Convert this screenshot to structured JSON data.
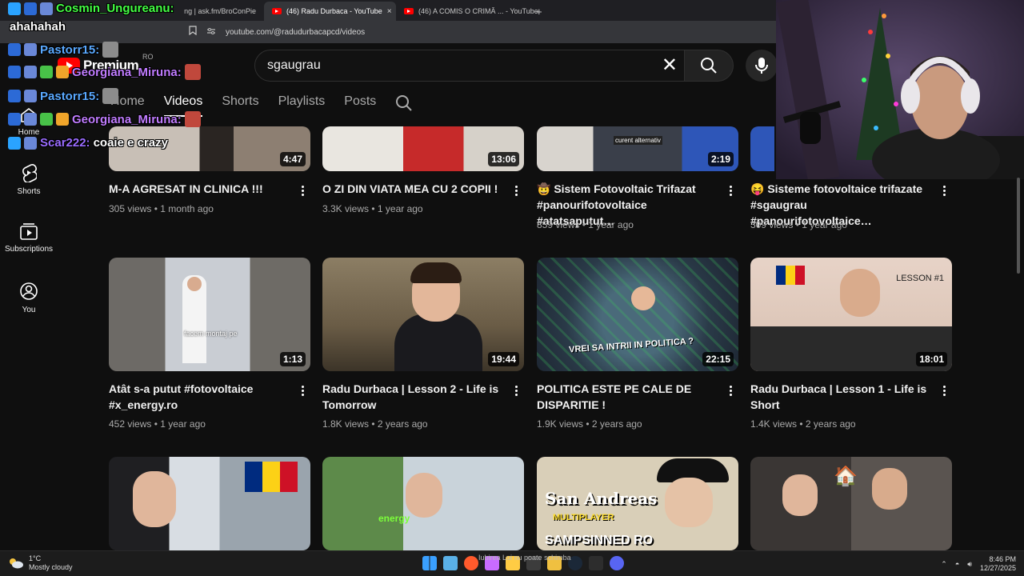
{
  "browser": {
    "tabs": [
      {
        "label": "ng | ask.fm/BroConPie"
      },
      {
        "label": "(46) Radu Durbaca - YouTube",
        "close": "×"
      },
      {
        "label": "(46) A COMIS O CRIMĂ ... - YouTube"
      }
    ],
    "new_tab": "+",
    "url": "youtube.com/@radudurbacapcd/videos"
  },
  "youtube": {
    "logo_text": "Premium",
    "region": "RO",
    "search_value": "sgaugrau",
    "clear": "✕",
    "channel_tabs": [
      "Home",
      "Videos",
      "Shorts",
      "Playlists",
      "Posts"
    ],
    "active_tab": "Videos",
    "sidebar": [
      {
        "label": "Home"
      },
      {
        "label": "Shorts"
      },
      {
        "label": "Subscriptions"
      },
      {
        "label": "You"
      }
    ],
    "videos": [
      {
        "title": "M-A AGRESAT IN CLINICA !!!",
        "meta": "305 views • 1 month ago",
        "duration": "4:47"
      },
      {
        "title": "O ZI DIN VIATA MEA CU 2 COPII !",
        "meta": "3.3K views • 1 year ago",
        "duration": "13:06"
      },
      {
        "title": "🤠 Sistem Fotovoltaic Trifazat #panourifotovoltaice #atatsaputut…",
        "meta": "859 views • 1 year ago",
        "duration": "2:19"
      },
      {
        "title": "😝 Sisteme fotovoltaice trifazate #sgaugrau #panourifotovoltaice…",
        "meta": "309 views • 1 year ago",
        "duration": ""
      },
      {
        "title": "Atât s-a putut #fotovoltaice #x_energy.ro",
        "meta": "452 views • 1 year ago",
        "duration": "1:13"
      },
      {
        "title": "Radu Durbaca | Lesson 2 - Life is Tomorrow",
        "meta": "1.8K views • 2 years ago",
        "duration": "19:44"
      },
      {
        "title": "POLITICA ESTE PE CALE DE DISPARITIE !",
        "meta": "1.9K views • 2 years ago",
        "duration": "22:15"
      },
      {
        "title": "Radu Durbaca | Lesson 1 - Life is Short",
        "meta": "1.4K views • 2 years ago",
        "duration": "18:01"
      },
      {
        "title": "",
        "meta": "",
        "duration": ""
      },
      {
        "title": "",
        "meta": "",
        "duration": ""
      },
      {
        "title": "",
        "meta": "",
        "duration": ""
      },
      {
        "title": "",
        "meta": "",
        "duration": ""
      }
    ],
    "thumb_texts": {
      "video3_caption": "curent alternativ",
      "video5_caption": "facem montaj pe",
      "video7_caption": "VREI SA INTRII IN POLITICA ?",
      "video8_lesson": "LESSON #1",
      "video10_caption": "energy",
      "video11_title": "San Andreas",
      "video11_sub": "MULTIPLAYER",
      "video11_bottom": "SAMPSINNED RO"
    }
  },
  "chat": [
    {
      "user": "Cosmin_Ungureanu:",
      "message": "ahahahah",
      "color": "#44ff44"
    },
    {
      "user": "Pastorr15:",
      "message": "",
      "color": "#5aa9ff"
    },
    {
      "user": "Georgiana_Miruna:",
      "message": "",
      "color": "#c07cff"
    },
    {
      "user": "Pastorr15:",
      "message": "",
      "color": "#5aa9ff"
    },
    {
      "user": "Georgiana_Miruna:",
      "message": "",
      "color": "#c07cff"
    },
    {
      "user": "Scar222:",
      "message": "coaie e crazy",
      "color": "#9a6cff"
    }
  ],
  "taskbar": {
    "temperature": "1°C",
    "weather": "Mostly cloudy",
    "overlay_text": "Iubirea Lui nu poate schimba",
    "time": "8:46 PM",
    "date": "12/27/2025"
  },
  "colors": {
    "bg": "#0f0f0f",
    "accent": "#ff0000",
    "text_secondary": "#aaaaaa"
  }
}
